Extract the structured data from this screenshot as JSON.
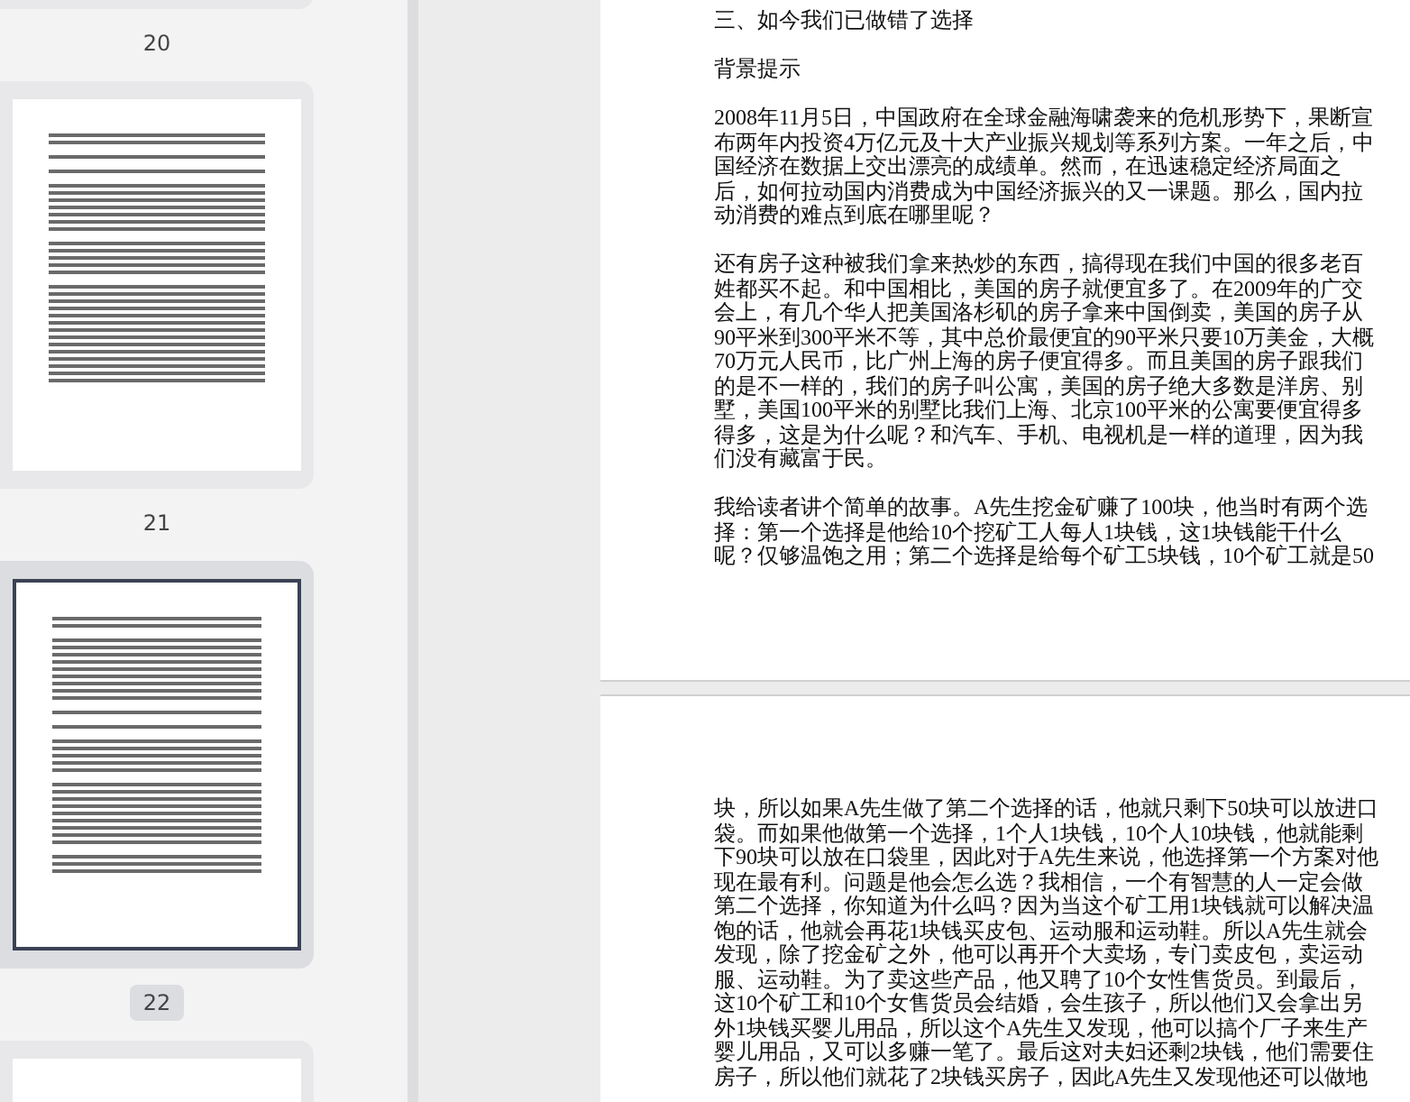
{
  "thumbnails": [
    {
      "kind": "top",
      "label": "20",
      "selected": false
    },
    {
      "kind": "full",
      "label": "21",
      "selected": false
    },
    {
      "kind": "full",
      "label": "22",
      "selected": true
    },
    {
      "kind": "bottom"
    }
  ],
  "pages": [
    {
      "paragraphs": [
        [
          "三、如今我们已做错了选择"
        ],
        [
          "背景提示"
        ],
        [
          "2008年11月5日，中国政府在全球金融海啸袭来的危机形势下，果断宣",
          "布两年内投资4万亿元及十大产业振兴规划等系列方案。一年之后，中",
          "国经济在数据上交出漂亮的成绩单。然而，在迅速稳定经济局面之",
          "后，如何拉动国内消费成为中国经济振兴的又一课题。那么，国内拉",
          "动消费的难点到底在哪里呢？"
        ],
        [
          "还有房子这种被我们拿来热炒的东西，搞得现在我们中国的很多老百",
          "姓都买不起。和中国相比，美国的房子就便宜多了。在2009年的广交",
          "会上，有几个华人把美国洛杉矶的房子拿来中国倒卖，美国的房子从",
          "90平米到300平米不等，其中总价最便宜的90平米只要10万美金，大概",
          "70万元人民币，比广州上海的房子便宜得多。而且美国的房子跟我们",
          "的是不一样的，我们的房子叫公寓，美国的房子绝大多数是洋房、别",
          "墅，美国100平米的别墅比我们上海、北京100平米的公寓要便宜得多",
          "得多，这是为什么呢？和汽车、手机、电视机是一样的道理，因为我",
          "们没有藏富于民。"
        ],
        [
          "我给读者讲个简单的故事。A先生挖金矿赚了100块，他当时有两个选",
          "择：第一个选择是他给10个挖矿工人每人1块钱，这1块钱能干什么",
          "呢？仅够温饱之用；第二个选择是给每个矿工5块钱，10个矿工就是50"
        ]
      ]
    },
    {
      "paragraphs": [
        [
          "块，所以如果A先生做了第二个选择的话，他就只剩下50块可以放进口",
          "袋。而如果他做第一个选择，1个人1块钱，10个人10块钱，他就能剩",
          "下90块可以放在口袋里，因此对于A先生来说，他选择第一个方案对他",
          "现在最有利。问题是他会怎么选？我相信，一个有智慧的人一定会做",
          "第二个选择，你知道为什么吗？因为当这个矿工用1块钱就可以解决温",
          "饱的话，他就会再花1块钱买皮包、运动服和运动鞋。所以A先生就会",
          "发现，除了挖金矿之外，他可以再开个大卖场，专门卖皮包，卖运动",
          "服、运动鞋。为了卖这些产品，他又聘了10个女性售货员。到最后，",
          "这10个矿工和10个女售货员会结婚，会生孩子，所以他们又会拿出另",
          "外1块钱买婴儿用品，所以这个A先生又发现，他可以搞个厂子来生产",
          "婴儿用品，又可以多赚一笔了。最后这对夫妇还剩2块钱，他们需要住",
          "房子，所以他们就花了2块钱买房子，因此A先生又发现他还可以做地"
        ]
      ]
    }
  ]
}
